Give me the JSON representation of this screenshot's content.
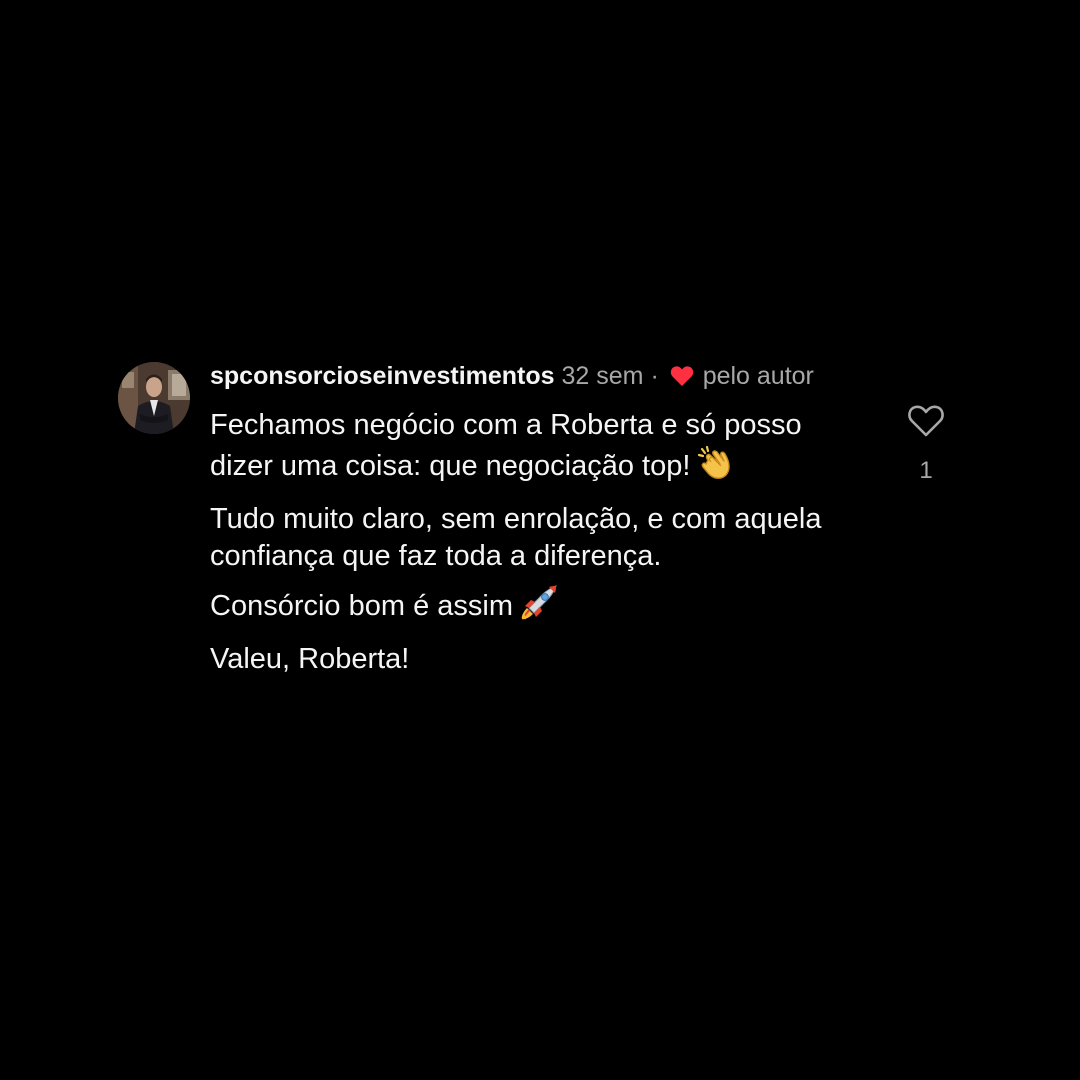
{
  "comment": {
    "username": "spconsorcioseinvestimentos",
    "time": "32 sem",
    "separator": "·",
    "liked_by_author_label": "pelo autor",
    "paragraphs": [
      "Fechamos negócio com a Roberta e só posso dizer uma coisa: que negociação top!",
      "Tudo muito claro, sem enrolação, e com aquela confiança que faz toda a diferença.",
      "Consórcio bom é assim",
      "Valeu, Roberta!"
    ],
    "like_count": "1"
  },
  "icons": {
    "author_like": "heart-filled-icon",
    "clap": "clapping-hands-emoji",
    "rocket": "rocket-emoji",
    "like_button": "heart-outline-icon"
  },
  "colors": {
    "background": "#000000",
    "primary_text": "#f5f5f5",
    "secondary_text": "#a8a8a8",
    "author_heart": "#ff3040"
  }
}
